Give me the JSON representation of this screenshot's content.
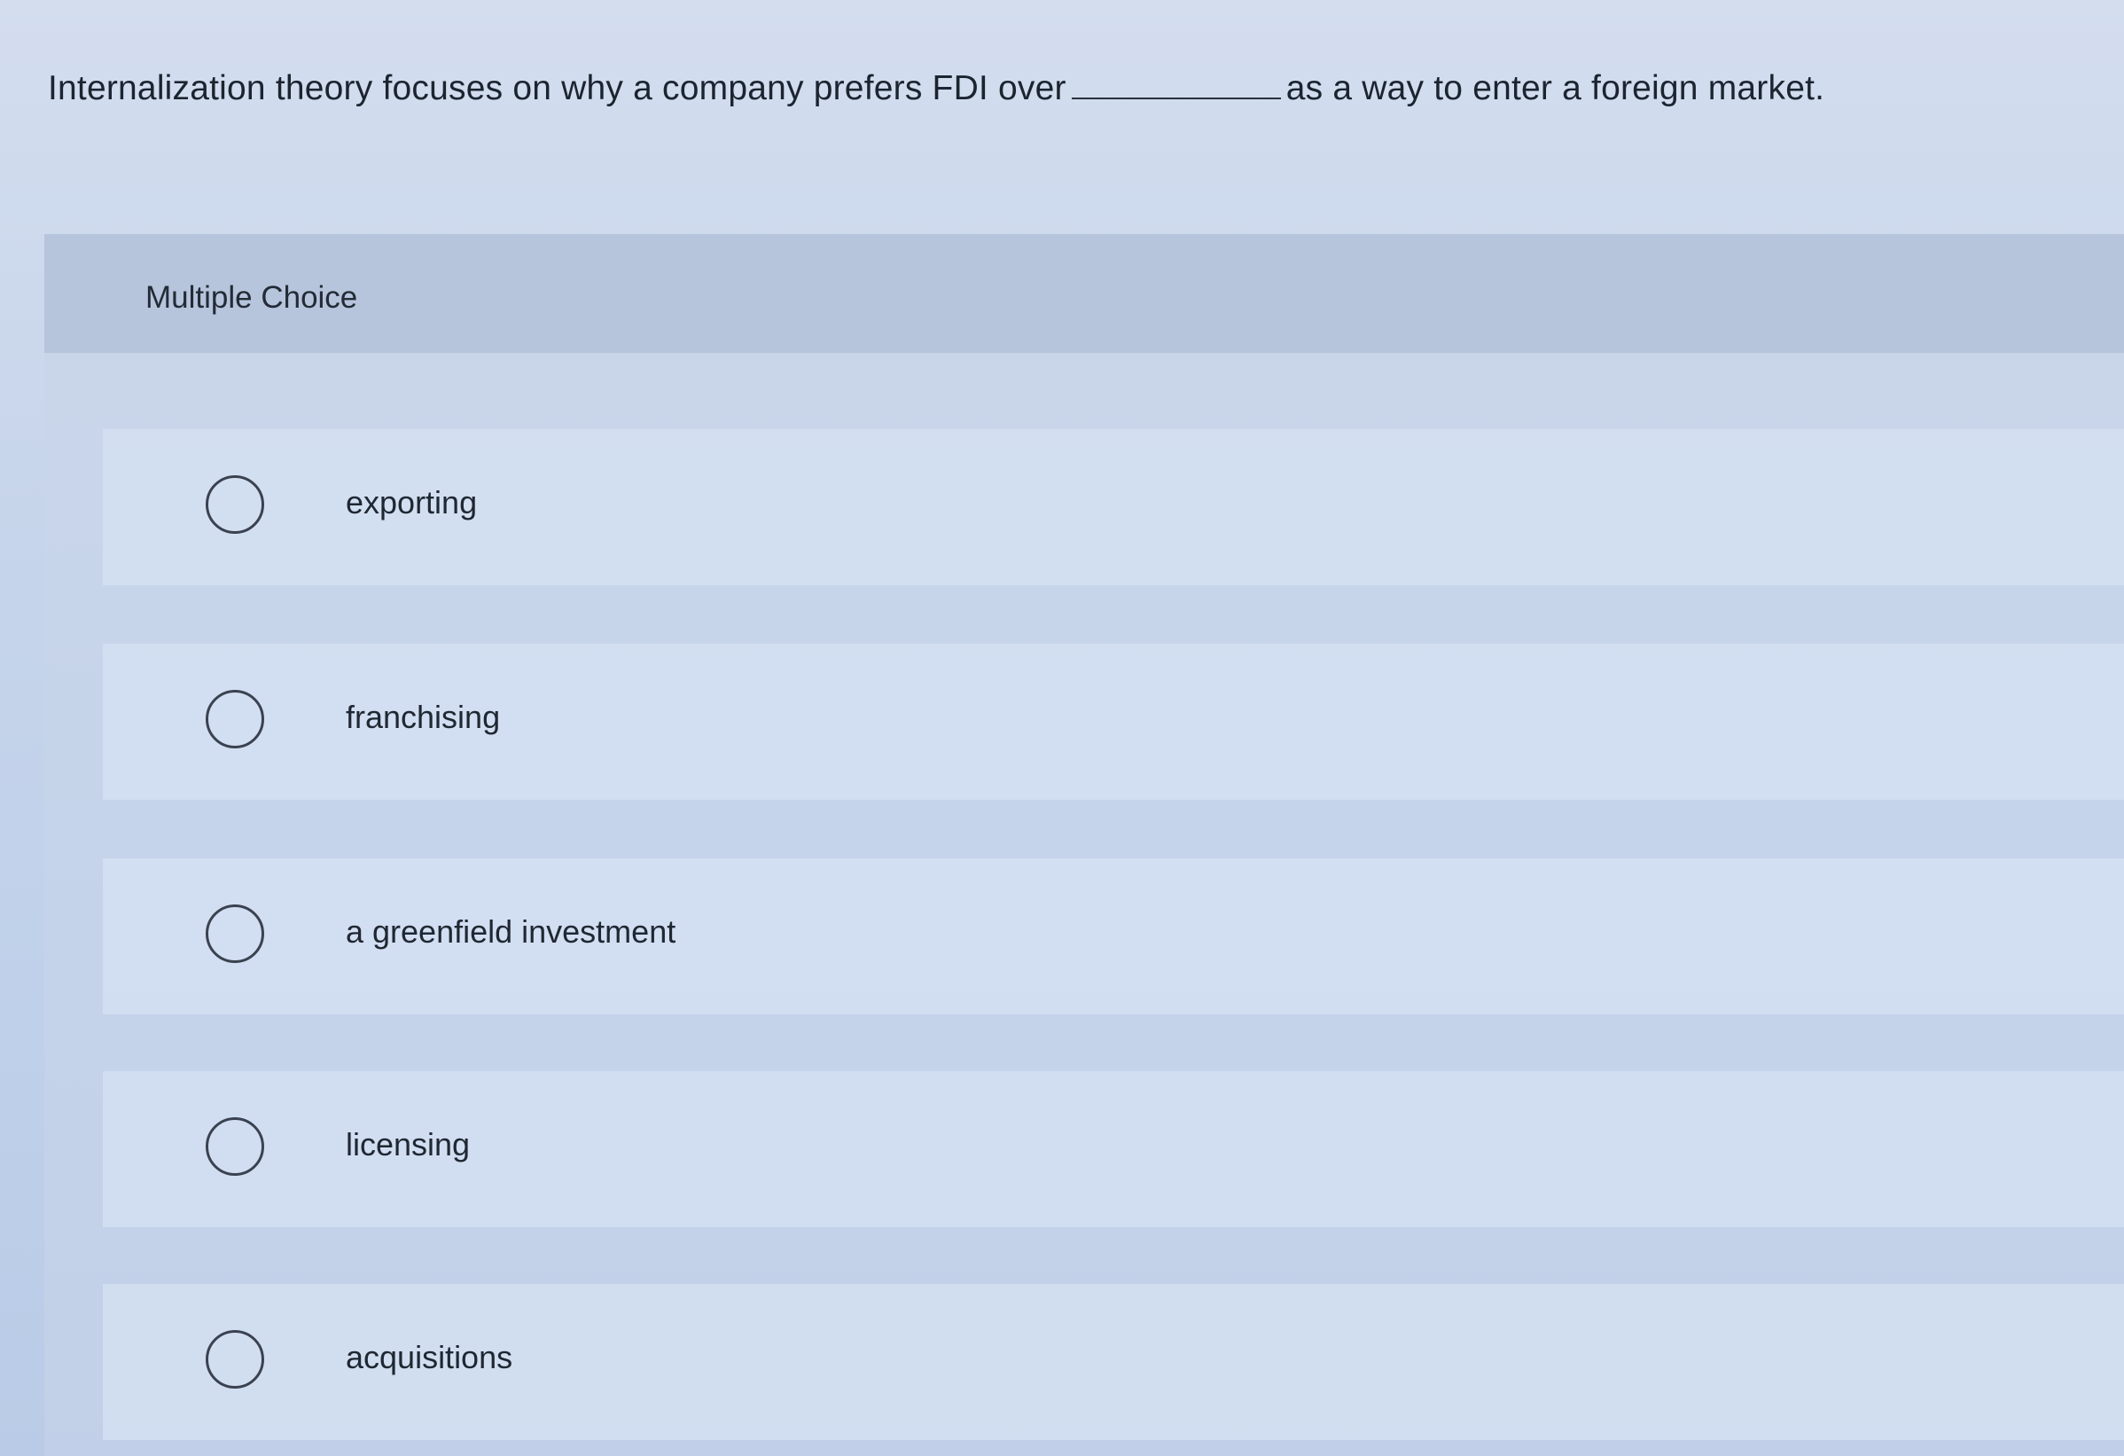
{
  "question": {
    "text_before": "Internalization theory focuses on why a company prefers FDI over",
    "text_after": "as a way to enter a foreign market."
  },
  "multiple_choice": {
    "header": "Multiple Choice",
    "options": [
      {
        "label": "exporting"
      },
      {
        "label": "franchising"
      },
      {
        "label": "a greenfield investment"
      },
      {
        "label": "licensing"
      },
      {
        "label": "acquisitions"
      }
    ]
  }
}
